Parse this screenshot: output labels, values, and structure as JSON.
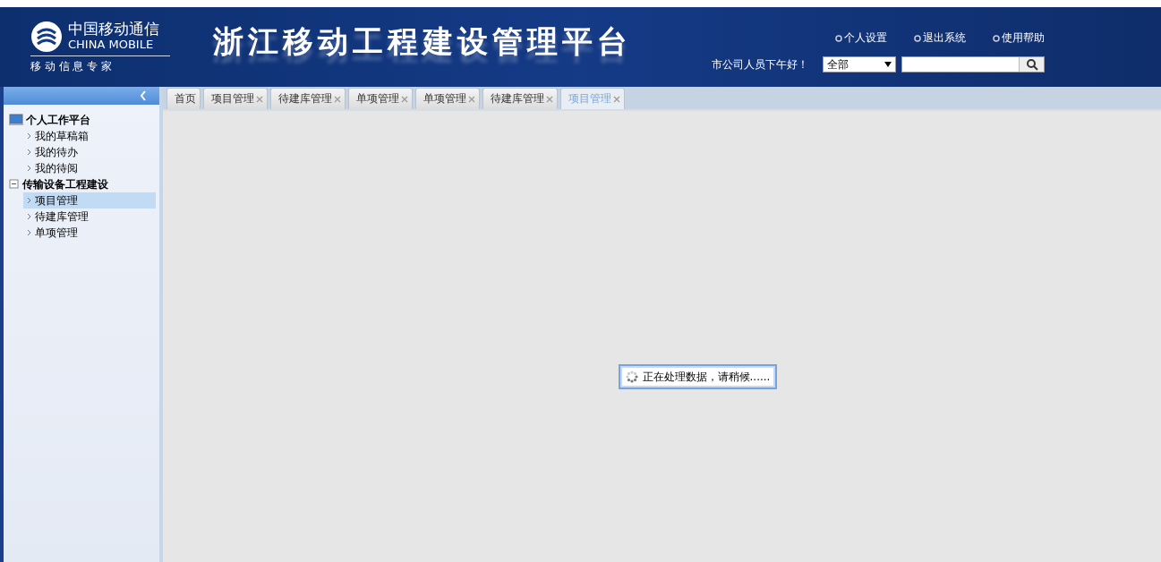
{
  "header": {
    "logo_cn": "中国移动通信",
    "logo_en": "CHINA MOBILE",
    "logo_slogan": "移 动 信 息 专 家",
    "title": "浙江移动工程建设管理平台",
    "links": [
      {
        "label": "个人设置"
      },
      {
        "label": "退出系统"
      },
      {
        "label": "使用帮助"
      }
    ],
    "greeting": "市公司人员下午好！",
    "scope_select": {
      "value": "全部"
    }
  },
  "tabs": [
    {
      "label": "首页",
      "closable": false,
      "selected": false
    },
    {
      "label": "项目管理",
      "closable": true,
      "selected": false
    },
    {
      "label": "待建库管理",
      "closable": true,
      "selected": false
    },
    {
      "label": "单项管理",
      "closable": true,
      "selected": false
    },
    {
      "label": "单项管理",
      "closable": true,
      "selected": false
    },
    {
      "label": "待建库管理",
      "closable": true,
      "selected": false
    },
    {
      "label": "项目管理",
      "closable": true,
      "selected": true
    }
  ],
  "sidebar": {
    "groups": [
      {
        "label": "个人工作平台",
        "kind": "computer",
        "children": [
          {
            "label": "我的草稿箱",
            "selected": false
          },
          {
            "label": "我的待办",
            "selected": false
          },
          {
            "label": "我的待阅",
            "selected": false
          }
        ]
      },
      {
        "label": "传输设备工程建设",
        "kind": "collapse",
        "children": [
          {
            "label": "项目管理",
            "selected": true
          },
          {
            "label": "待建库管理",
            "selected": false
          },
          {
            "label": "单项管理",
            "selected": false
          }
        ]
      }
    ]
  },
  "loading": {
    "message": "正在处理数据，请稍候......"
  }
}
